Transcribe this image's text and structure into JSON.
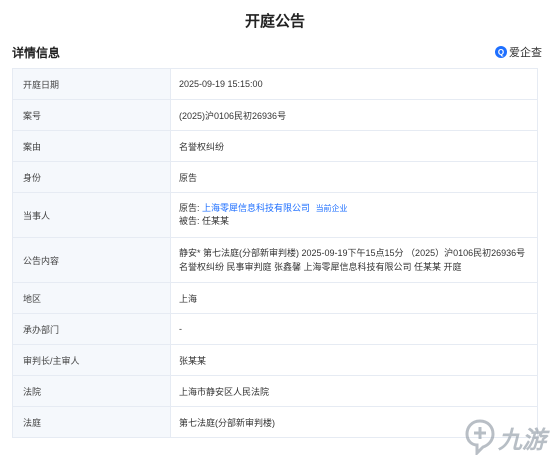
{
  "page": {
    "title": "开庭公告"
  },
  "section": {
    "title": "详情信息",
    "brand": "爱企查"
  },
  "rows": {
    "time": {
      "label": "开庭日期",
      "value": "2025-09-19 15:15:00"
    },
    "case_no": {
      "label": "案号",
      "value": "(2025)沪0106民初26936号"
    },
    "cause": {
      "label": "案由",
      "value": "名誉权纠纷"
    },
    "identity": {
      "label": "身份",
      "value": "原告"
    },
    "parties": {
      "label": "当事人",
      "plaintiff_prefix": "原告:",
      "plaintiff": "上海零犀信息科技有限公司",
      "current_tag": "当前企业",
      "defendant_prefix": "被告:",
      "defendant": "任某某"
    },
    "content": {
      "label": "公告内容",
      "value": "静安* 第七法庭(分部新审判楼) 2025-09-19下午15点15分 （2025）沪0106民初26936号 名誉权纠纷 民事审判庭 张鑫馨 上海零犀信息科技有限公司 任某某 开庭"
    },
    "region": {
      "label": "地区",
      "value": "上海"
    },
    "department": {
      "label": "承办部门",
      "value": "-"
    },
    "judge": {
      "label": "审判长/主审人",
      "value": "张某某"
    },
    "court": {
      "label": "法院",
      "value": "上海市静安区人民法院"
    },
    "courtroom": {
      "label": "法庭",
      "value": "第七法庭(分部新审判楼)"
    }
  },
  "watermark": {
    "text": "九游"
  }
}
